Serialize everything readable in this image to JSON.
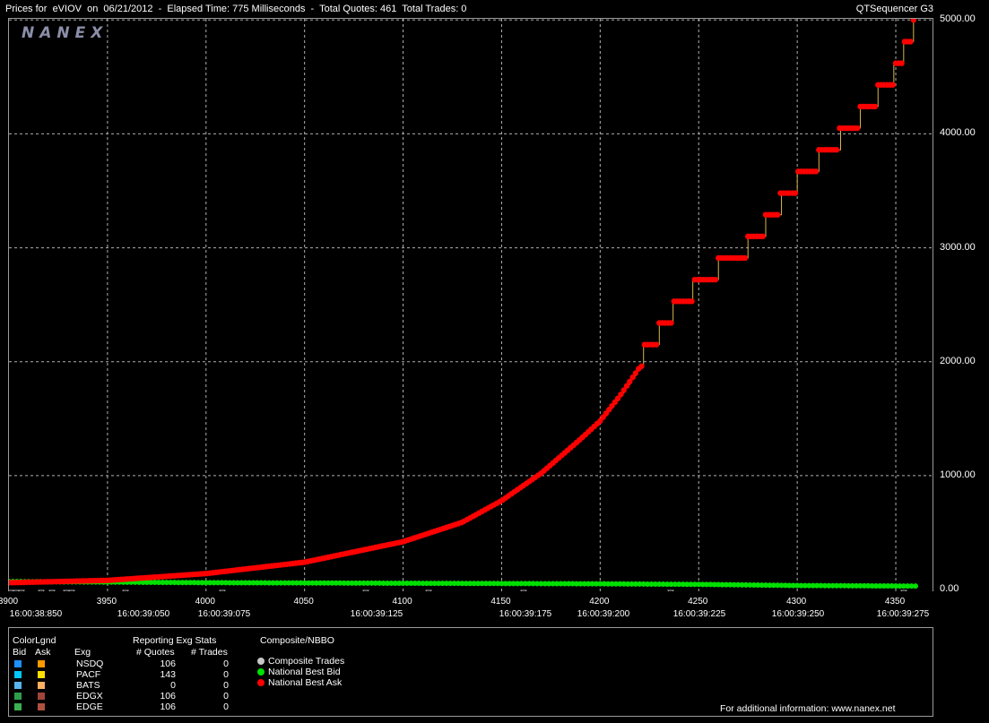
{
  "header": {
    "title": "Prices for  eVIOV  on  06/21/2012  -  Elapsed Time: 775 Milliseconds  -  Total Quotes: 461  Total Trades: 0",
    "app": "QTSequencer G3"
  },
  "logo": "NANEX",
  "colors": {
    "bid": "#00e000",
    "ask": "#ff0000",
    "step": "#d9b54a",
    "grid": "#b0b0b0"
  },
  "chart_data": {
    "type": "scatter",
    "y_axis_side": "right",
    "ylim": [
      0,
      5000
    ],
    "yticks": [
      "5000.00",
      "4000.00",
      "3000.00",
      "2000.00",
      "1000.00",
      "0.00"
    ],
    "xlim": [
      3900,
      4365
    ],
    "xticks": [
      "3900",
      "3950",
      "4000",
      "4050",
      "4100",
      "4150",
      "4200",
      "4250",
      "4300",
      "4350"
    ],
    "time_labels": [
      "16:00:38:850",
      "16:00:39:050",
      "16:00:39:075",
      "16:00:39:125",
      "16:00:39:175",
      "16:00:39:200",
      "16:00:39:225",
      "16:00:39:250",
      "16:00:39:275"
    ],
    "grid": true,
    "series": [
      {
        "name": "National Best Ask",
        "x": [
          3900,
          3950,
          4000,
          4050,
          4100,
          4130,
          4150,
          4170,
          4190,
          4200,
          4210,
          4220,
          4230,
          4240,
          4250,
          4260,
          4270,
          4280,
          4290,
          4300,
          4310,
          4320,
          4330,
          4340,
          4350,
          4355,
          4360
        ],
        "y": [
          60,
          80,
          140,
          240,
          420,
          590,
          780,
          1020,
          1320,
          1480,
          1700,
          1950,
          2200,
          2460,
          2610,
          2760,
          2880,
          3040,
          3300,
          3520,
          3700,
          3870,
          4060,
          4270,
          4490,
          4700,
          4920
        ]
      },
      {
        "name": "National Best Bid",
        "x": [
          3900,
          4000,
          4100,
          4200,
          4250,
          4300,
          4360
        ],
        "y": [
          70,
          60,
          55,
          50,
          45,
          35,
          30
        ]
      }
    ]
  },
  "legend": {
    "colorlgnd": "ColorLgnd",
    "bid": "Bid",
    "ask": "Ask",
    "exg_hdr": "Exg",
    "reporting": "Reporting Exg Stats",
    "quotes_hdr": "# Quotes",
    "trades_hdr": "# Trades",
    "composite_hdr": "Composite/NBBO",
    "rows": [
      {
        "exg": "NSDQ",
        "quotes": "106",
        "trades": "0",
        "bid": "#1e90ff",
        "ask": "#ff9900"
      },
      {
        "exg": "PACF",
        "quotes": "143",
        "trades": "0",
        "bid": "#00c8ff",
        "ask": "#ffe000"
      },
      {
        "exg": "BATS",
        "quotes": "0",
        "trades": "0",
        "bid": "#5ab4f0",
        "ask": "#ffb060"
      },
      {
        "exg": "EDGX",
        "quotes": "106",
        "trades": "0",
        "bid": "#2e9e4a",
        "ask": "#a0453a"
      },
      {
        "exg": "EDGE",
        "quotes": "106",
        "trades": "0",
        "bid": "#3cb050",
        "ask": "#b05040"
      }
    ],
    "composite": [
      {
        "label": "Composite Trades",
        "color": "#c8c8c8"
      },
      {
        "label": "National Best Bid",
        "color": "#00e000"
      },
      {
        "label": "National Best Ask",
        "color": "#ff0000"
      }
    ],
    "info": "For additional information: www.nanex.net"
  }
}
